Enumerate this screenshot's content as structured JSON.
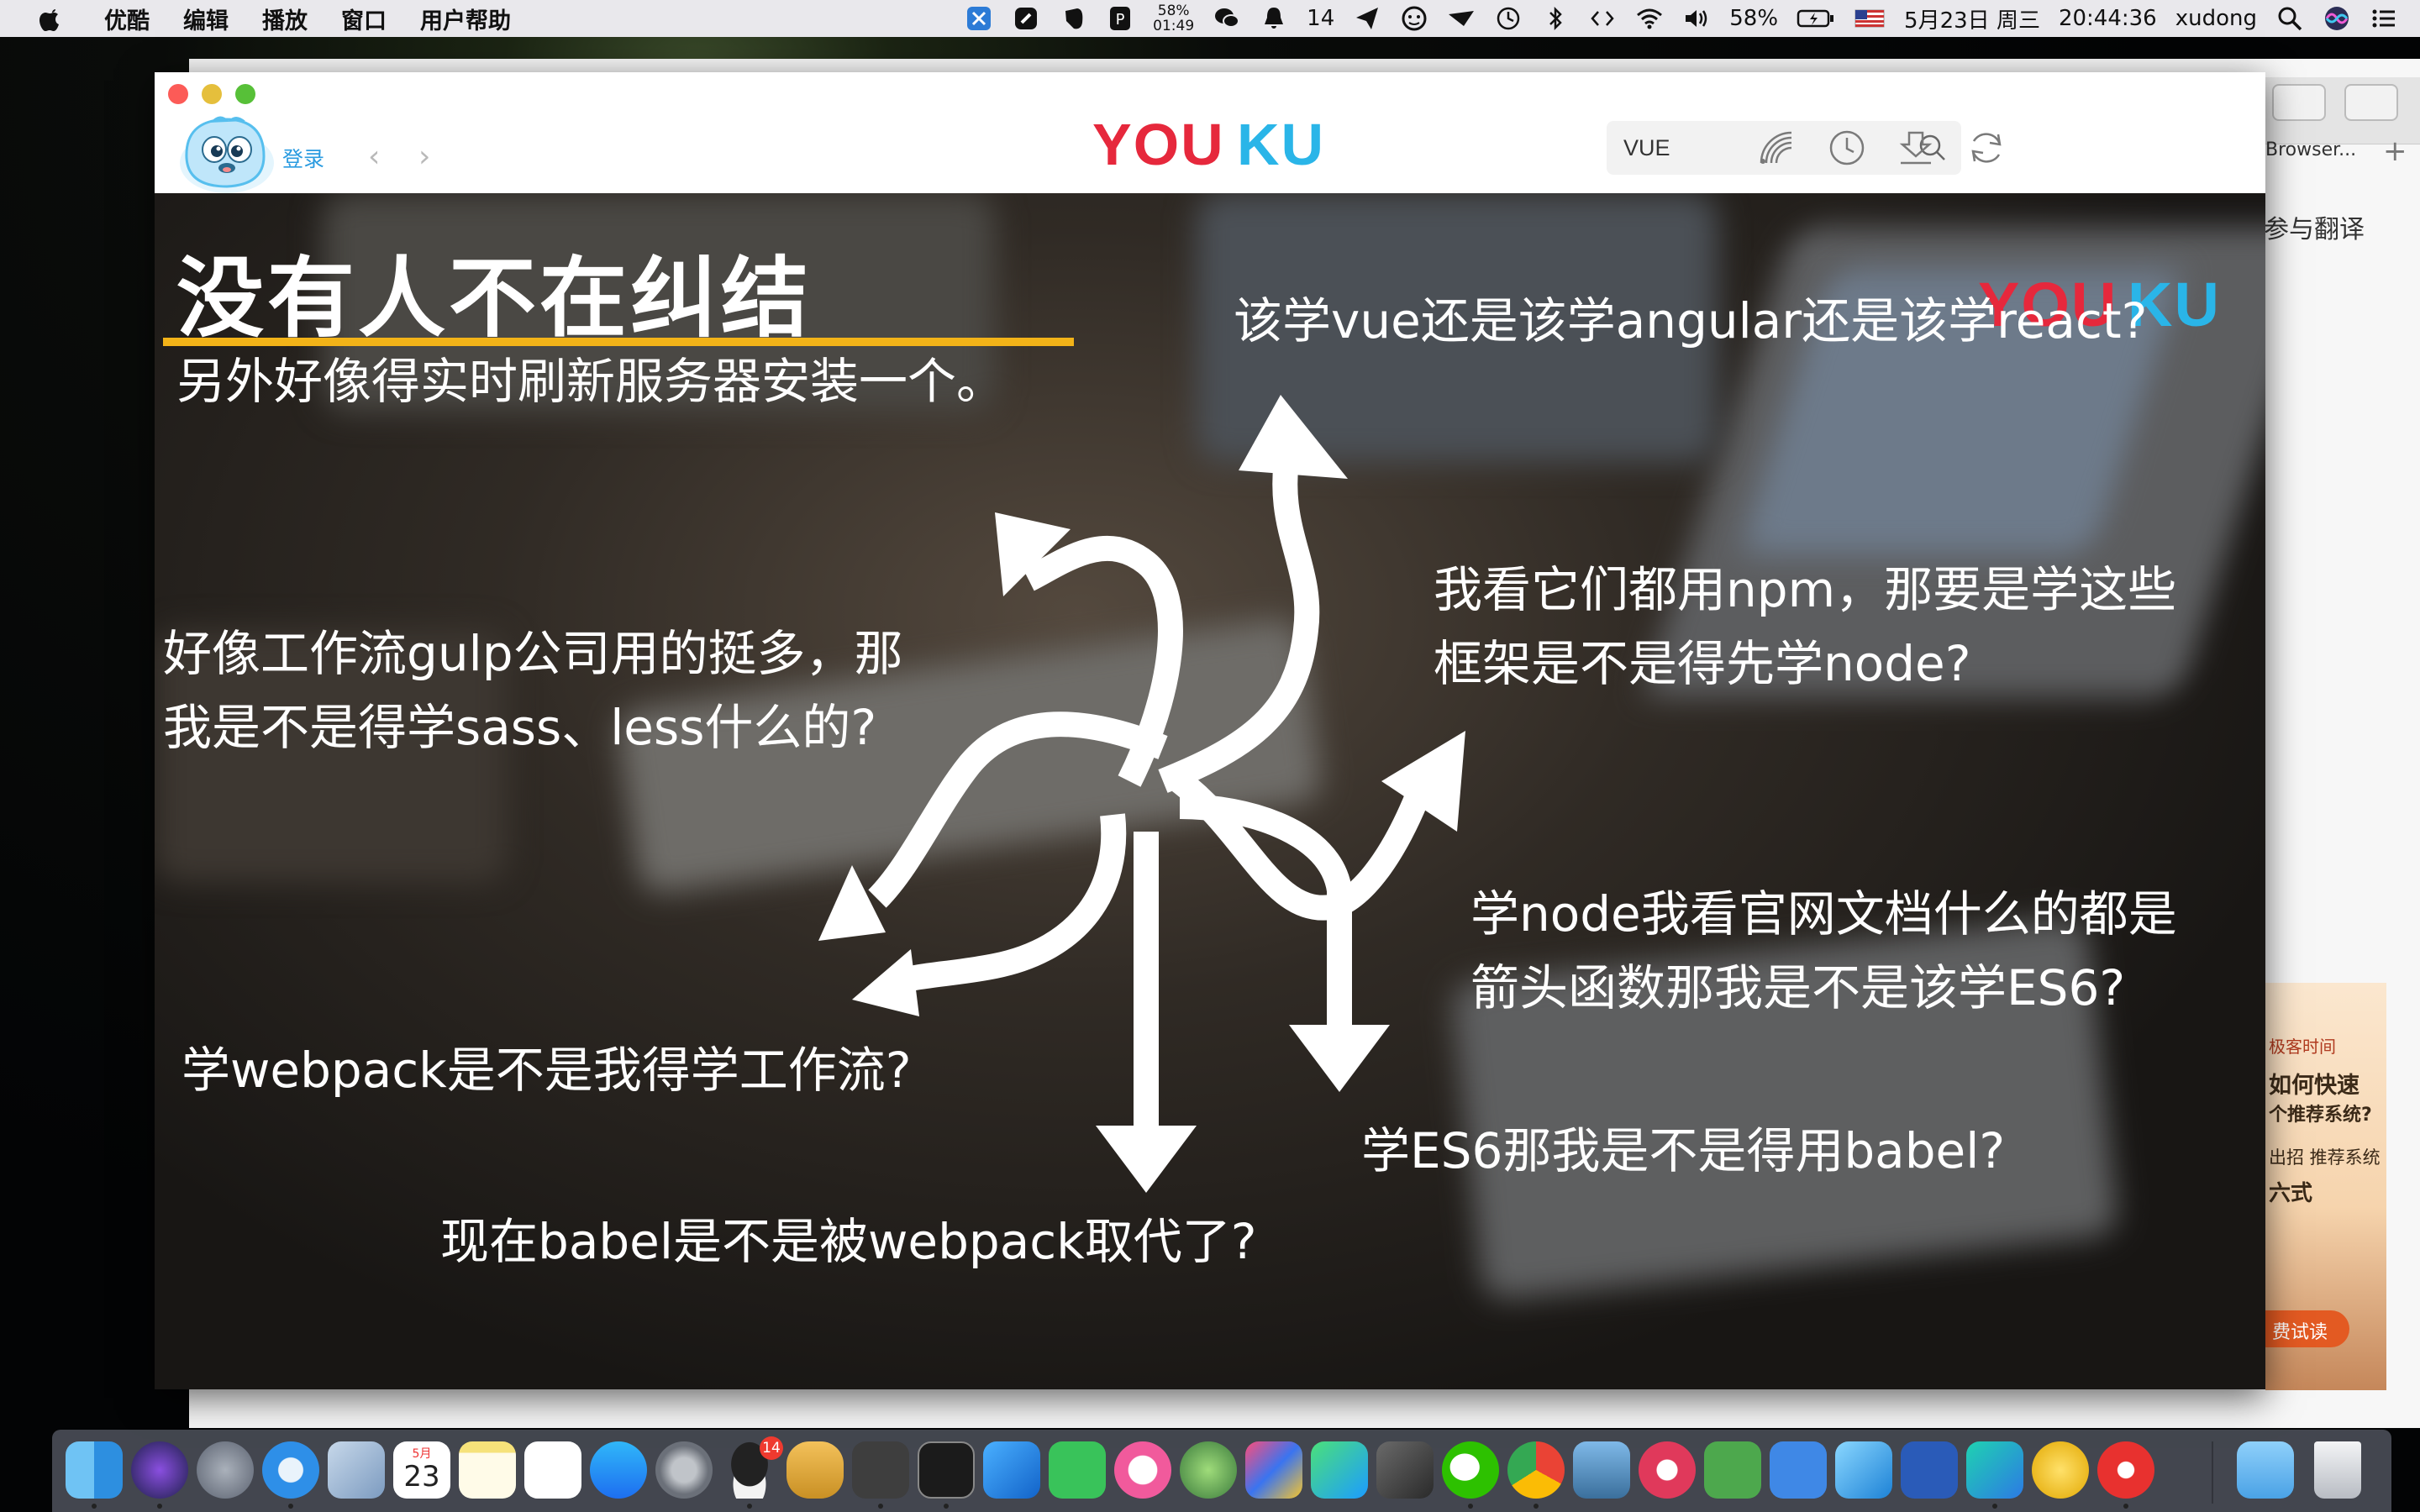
{
  "menubar": {
    "app_name": "优酷",
    "menus": [
      "编辑",
      "播放",
      "窗口",
      "用户帮助"
    ],
    "battery_small_top": "58%",
    "battery_small_bottom": "01:49",
    "notification_count": "14",
    "battery_percent": "58%",
    "date": "5月23日 周三",
    "time": "20:44:36",
    "username": "xudong"
  },
  "background_browser": {
    "tab_text": "Browser...",
    "link_text": "参与翻译",
    "ad": {
      "line1": "极客时间",
      "line2": "如何快速",
      "line2b": "个推荐系统?",
      "line3": "出招 推荐系统",
      "line4": "六式",
      "button": "费试读"
    }
  },
  "player": {
    "login_label": "登录",
    "back_arrow": "‹",
    "forward_arrow": "›",
    "logo_text": "YOUKU",
    "search": {
      "value": "VUE"
    },
    "toolbar_icons": [
      "signal-icon",
      "history-icon",
      "download-icon",
      "refresh-icon"
    ]
  },
  "slide": {
    "title": "没有人不在纠结",
    "watermark": "YOUKU",
    "questions": {
      "q1": "该学vue还是该学angular还是该学react?",
      "q2": "另外好像得实时刷新服务器安装一个。",
      "q3_line1": "我看它们都用npm，那要是学这些",
      "q3_line2": "框架是不是得先学node?",
      "q4_line1": "好像工作流gulp公司用的挺多，那",
      "q4_line2": "我是不是得学sass、less什么的?",
      "q5_line1": "学node我看官网文档什么的都是",
      "q5_line2": "箭头函数那我是不是该学ES6?",
      "q6": "学webpack是不是我得学工作流?",
      "q7": "学ES6那我是不是得用babel?",
      "q8": "现在babel是不是被webpack取代了?"
    }
  },
  "dock": {
    "calendar_month": "5月",
    "calendar_day": "23",
    "qq_badge": "14",
    "apps": [
      "finder-icon",
      "siri-icon",
      "launchpad-icon",
      "safari-icon",
      "mail-icon",
      "calendar-icon",
      "notes-icon",
      "reminders-icon",
      "app-store-icon",
      "system-preferences-icon",
      "qq-icon",
      "sequel-icon",
      "sublime-icon",
      "terminal-icon",
      "xcode-icon",
      "facetime-icon",
      "itunes-icon",
      "android-studio-icon",
      "intellij-icon",
      "infuse-icon",
      "rar-icon",
      "wechat-icon",
      "chrome-icon",
      "preview-icon",
      "pocket-icon",
      "evernote-icon",
      "pen-icon",
      "xmind-icon",
      "word-icon",
      "webstorm-icon",
      "music-icon",
      "video-icon",
      "folder-icon",
      "trash-icon"
    ]
  },
  "colors": {
    "youku_red": "#e6283c",
    "youku_blue": "#2ab5e8",
    "title_underline": "#f2b318",
    "login_blue": "#2a9be0"
  }
}
